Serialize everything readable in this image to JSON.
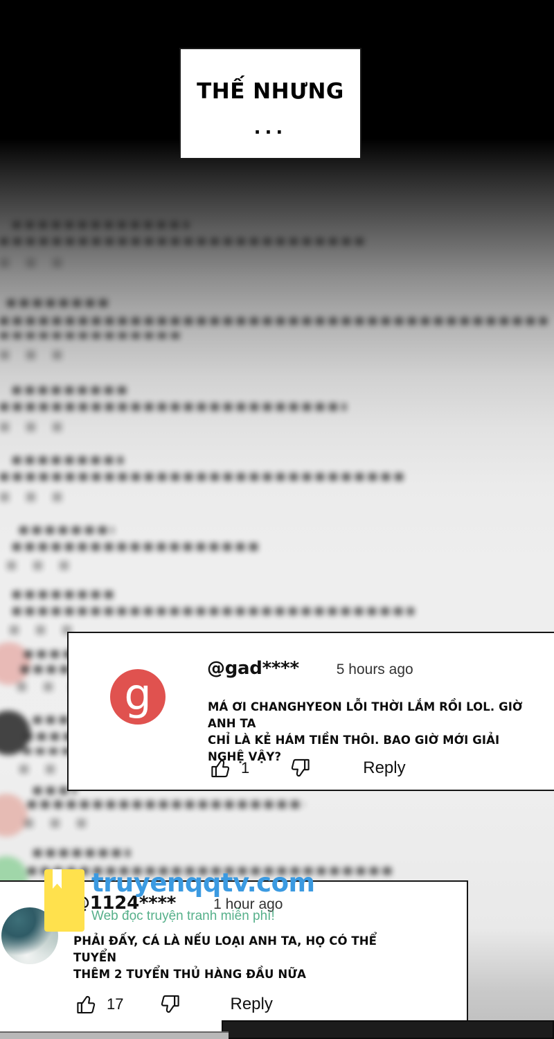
{
  "panel": {
    "placard": {
      "title": "THẾ NHƯNG",
      "dots": "..."
    }
  },
  "comments": [
    {
      "avatar_letter": "g",
      "avatar_color": "#e0524f",
      "username": "@gad****",
      "timestamp": "5 hours ago",
      "body": "MÁ ƠI CHANGHYEON LỖI THỜI LẮM RỒI LOL. GIỜ ANH TA\nCHỈ LÀ KẺ HÁM TIỀN THÔI. BAO GIỜ MỚI GIẢI NGHỆ VẬY?",
      "like_count": "1",
      "dislike_count": "",
      "reply_label": "Reply"
    },
    {
      "avatar_letter": "",
      "avatar_color": "#5f8a8c",
      "username": "@1124****",
      "timestamp": "1 hour ago",
      "body": "PHẢI ĐẤY, CÁ LÀ NẾU LOẠI ANH TA, HỌ CÓ THỂ TUYỂN\nTHÊM 2 TUYỂN THỦ HÀNG ĐẦU NỮA",
      "like_count": "17",
      "dislike_count": "",
      "reply_label": "Reply"
    }
  ],
  "watermark": {
    "domain": "truyenqqtv.com",
    "tagline": "Web đọc truyện tranh miễn phí!",
    "domain_color": "#3b9ae1",
    "tagline_color": "#56b08a",
    "book_color": "#ffe14d"
  }
}
